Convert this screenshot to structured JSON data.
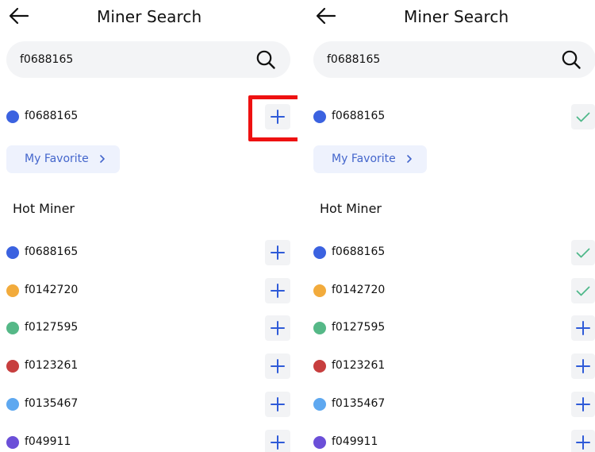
{
  "colors": {
    "accent_blue": "#2f5bd8",
    "check_green": "#4fb88a",
    "search_bg": "#f3f4f6",
    "button_bg": "#f2f3f5",
    "favorite_bg": "#eef2fd",
    "favorite_text": "#4466cc",
    "highlight_red": "#ee1111"
  },
  "screens": [
    {
      "title": "Miner Search",
      "search_value": "f0688165",
      "result": {
        "id": "f0688165",
        "color": "#3b62e0",
        "action": "add"
      },
      "favorite_label": "My Favorite",
      "hot_title": "Hot Miner",
      "hot_miners": [
        {
          "id": "f0688165",
          "color": "#3b62e0",
          "action": "add"
        },
        {
          "id": "f0142720",
          "color": "#f2ab3c",
          "action": "add"
        },
        {
          "id": "f0127595",
          "color": "#55b887",
          "action": "add"
        },
        {
          "id": "f0123261",
          "color": "#c73e3e",
          "action": "add"
        },
        {
          "id": "f0135467",
          "color": "#5ea8f0",
          "action": "add"
        },
        {
          "id": "f049911",
          "color": "#6b4fd8",
          "action": "add"
        }
      ]
    },
    {
      "title": "Miner Search",
      "search_value": "f0688165",
      "result": {
        "id": "f0688165",
        "color": "#3b62e0",
        "action": "added"
      },
      "favorite_label": "My Favorite",
      "hot_title": "Hot Miner",
      "hot_miners": [
        {
          "id": "f0688165",
          "color": "#3b62e0",
          "action": "added"
        },
        {
          "id": "f0142720",
          "color": "#f2ab3c",
          "action": "added"
        },
        {
          "id": "f0127595",
          "color": "#55b887",
          "action": "add"
        },
        {
          "id": "f0123261",
          "color": "#c73e3e",
          "action": "add"
        },
        {
          "id": "f0135467",
          "color": "#5ea8f0",
          "action": "add"
        },
        {
          "id": "f049911",
          "color": "#6b4fd8",
          "action": "add"
        }
      ]
    }
  ]
}
